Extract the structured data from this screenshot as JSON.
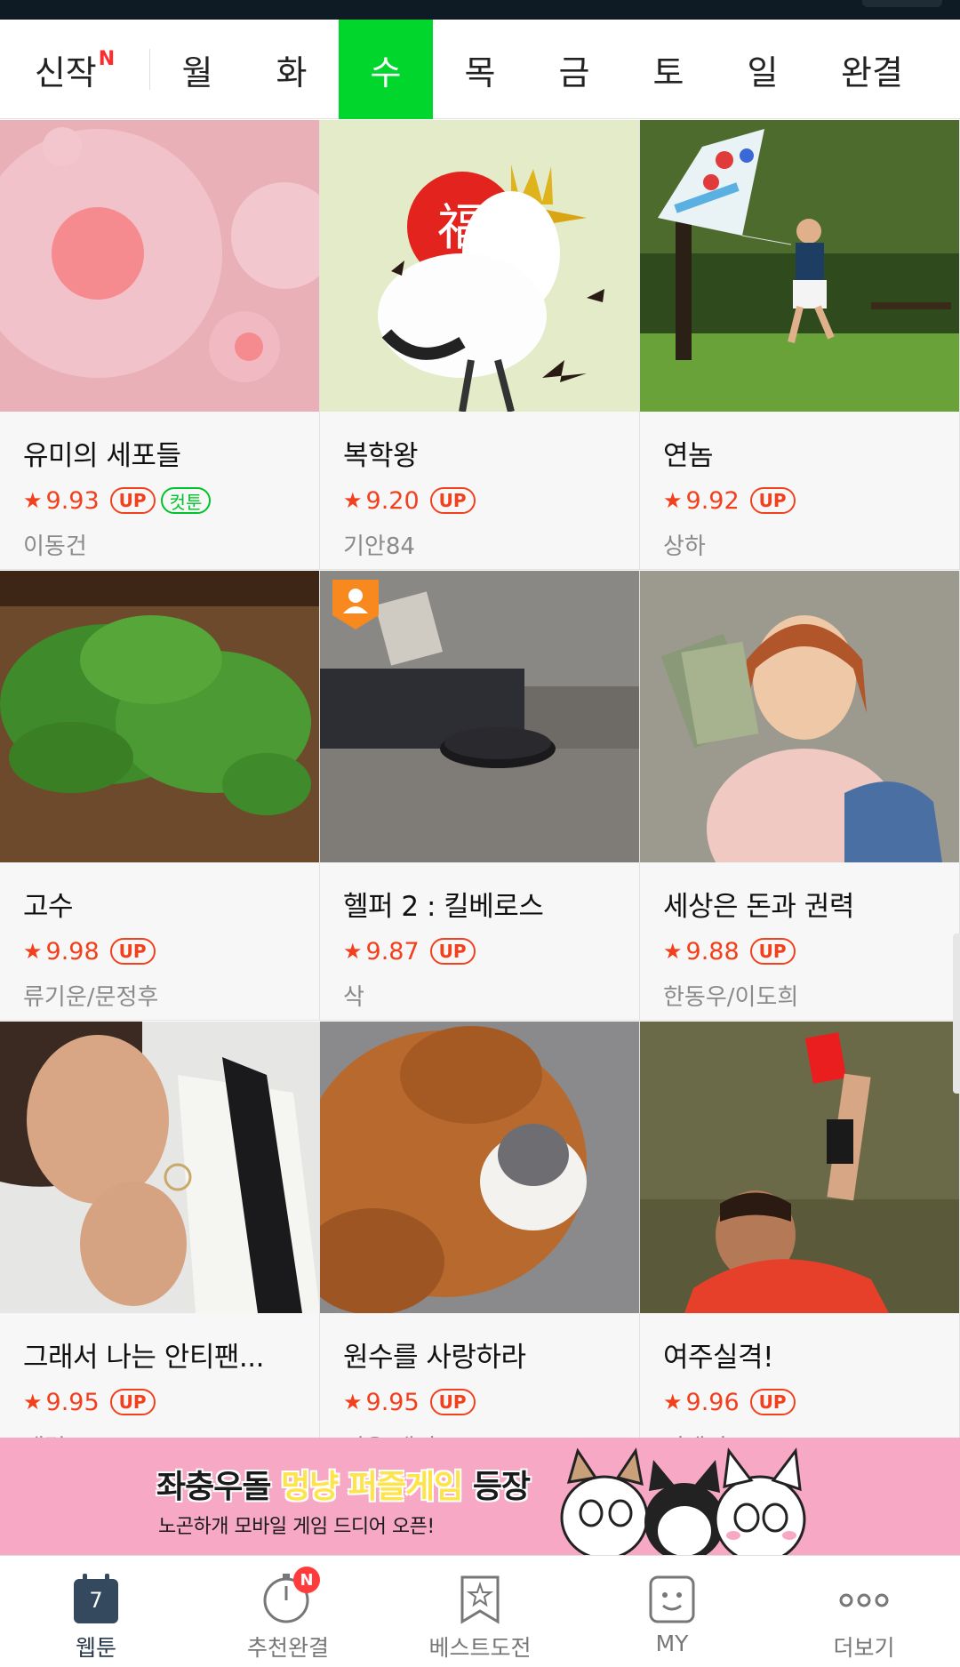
{
  "tabs": [
    {
      "label": "신작",
      "new_mark": "N"
    },
    {
      "label": "월"
    },
    {
      "label": "화"
    },
    {
      "label": "수",
      "active": true
    },
    {
      "label": "목"
    },
    {
      "label": "금"
    },
    {
      "label": "토"
    },
    {
      "label": "일"
    },
    {
      "label": "완결"
    }
  ],
  "cards": [
    {
      "title": "유미의 세포들",
      "rating": "9.93",
      "badge": "UP",
      "badge2": "컷툰",
      "author": "이동건"
    },
    {
      "title": "복학왕",
      "rating": "9.20",
      "badge": "UP",
      "author": "기안84"
    },
    {
      "title": "연놈",
      "rating": "9.92",
      "badge": "UP",
      "author": "상하"
    },
    {
      "title": "고수",
      "rating": "9.98",
      "badge": "UP",
      "author": "류기운/문정후"
    },
    {
      "title": "헬퍼 2 : 킬베로스",
      "rating": "9.87",
      "badge": "UP",
      "author": "삭"
    },
    {
      "title": "세상은 돈과 권력",
      "rating": "9.88",
      "badge": "UP",
      "author": "한동우/이도희"
    },
    {
      "title": "그래서 나는 안티팬...",
      "rating": "9.95",
      "badge": "UP",
      "author": "재림"
    },
    {
      "title": "원수를 사랑하라",
      "rating": "9.95",
      "badge": "UP",
      "author": "정유/태건"
    },
    {
      "title": "여주실격!",
      "rating": "9.96",
      "badge": "UP",
      "author": "기맹기"
    }
  ],
  "star_glyph": "★",
  "banner": {
    "line1_a": "좌충우돌 ",
    "line1_b": "멍냥 퍼즐게임",
    "line1_c": " 등장",
    "line2": "노곤하개 모바일 게임 드디어 오픈!"
  },
  "bottom_nav": [
    {
      "label": "웹툰",
      "icon": "calendar-icon",
      "number": "7"
    },
    {
      "label": "추천완결",
      "icon": "stopwatch-icon",
      "new_mark": "N"
    },
    {
      "label": "베스트도전",
      "icon": "bookmark-star-icon"
    },
    {
      "label": "MY",
      "icon": "smile-face-icon"
    },
    {
      "label": "더보기",
      "icon": "more-dots-icon"
    }
  ],
  "colors": {
    "accent_green": "#00d62c",
    "rating_red": "#f2401d",
    "banner_pink": "#f7a8c4"
  }
}
